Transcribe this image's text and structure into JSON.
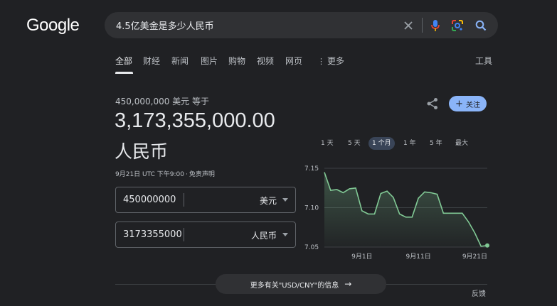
{
  "logo": "Google",
  "search": {
    "query": "4.5亿美金是多少人民币"
  },
  "tabs": [
    {
      "label": "全部",
      "active": true
    },
    {
      "label": "财经"
    },
    {
      "label": "新闻"
    },
    {
      "label": "图片"
    },
    {
      "label": "购物"
    },
    {
      "label": "视频"
    },
    {
      "label": "网页"
    },
    {
      "label": "更多"
    }
  ],
  "tools_label": "工具",
  "converter": {
    "from_line": "450,000,000 美元 等于",
    "result_amount": "3,173,355,000.00",
    "result_unit": "人民币",
    "timestamp": "9月21日 UTC 下午9:00",
    "disclaimer": "免责声明",
    "from": {
      "value": "450000000",
      "currency": "美元"
    },
    "to": {
      "value": "3173355000.0",
      "currency": "人民币"
    },
    "follow_label": "关注"
  },
  "ranges": [
    "1 天",
    "5 天",
    "1 个月",
    "1 年",
    "5 年",
    "最大"
  ],
  "active_range": "1 个月",
  "chart_data": {
    "type": "line",
    "y_ticks": [
      "7.15",
      "7.10",
      "7.05"
    ],
    "x_ticks": [
      "9月1日",
      "9月11日",
      "9月21日"
    ],
    "ylim": [
      7.05,
      7.15
    ],
    "values": [
      7.145,
      7.122,
      7.123,
      7.119,
      7.124,
      7.125,
      7.096,
      7.092,
      7.092,
      7.118,
      7.121,
      7.113,
      7.092,
      7.088,
      7.088,
      7.112,
      7.12,
      7.119,
      7.117,
      7.093,
      7.093,
      7.093,
      7.093,
      7.082,
      7.068,
      7.051,
      7.052
    ],
    "tick_index": [
      6,
      15,
      26
    ],
    "line_color": "#81c995"
  },
  "more_info": "更多有关\"USD/CNY\"的信息",
  "feedback": "反馈"
}
